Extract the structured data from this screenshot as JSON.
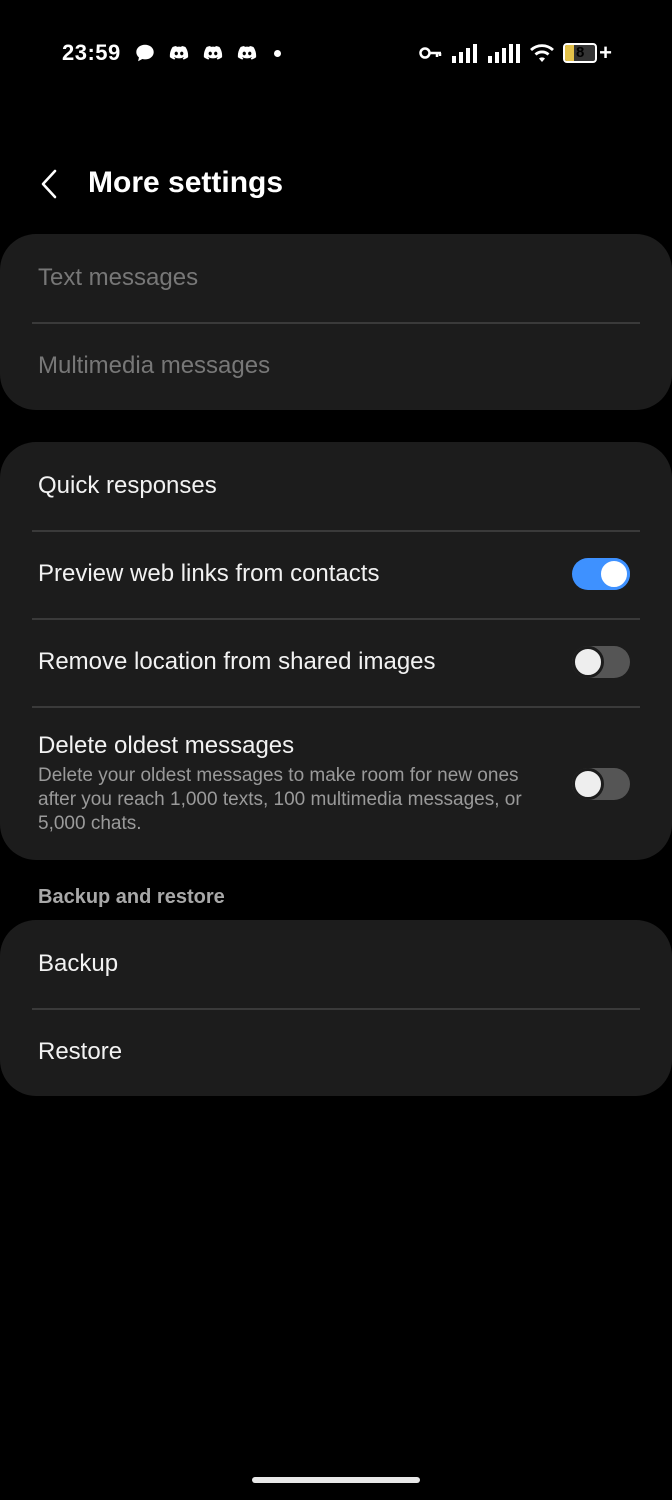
{
  "status_bar": {
    "time": "23:59",
    "notification_icons": [
      "chat-bubble-icon",
      "discord-icon",
      "discord-icon",
      "discord-icon"
    ],
    "system_icons": [
      "vpn-key-icon",
      "signal-icon",
      "signal-icon",
      "wifi-icon"
    ],
    "battery_level": "8",
    "battery_color": "#e3c14a"
  },
  "header": {
    "title": "More settings"
  },
  "group1": {
    "items": [
      {
        "label": "Text messages"
      },
      {
        "label": "Multimedia messages"
      }
    ]
  },
  "group2": {
    "items": [
      {
        "label": "Quick responses"
      },
      {
        "label": "Preview web links from contacts",
        "toggle": "on"
      },
      {
        "label": "Remove location from shared images",
        "toggle": "off"
      },
      {
        "label": "Delete oldest messages",
        "description": "Delete your oldest messages to make room for new ones after you reach 1,000 texts, 100 multimedia messages, or 5,000 chats.",
        "toggle": "off"
      }
    ]
  },
  "backup_section": {
    "header": "Backup and restore",
    "items": [
      {
        "label": "Backup"
      },
      {
        "label": "Restore"
      }
    ]
  },
  "colors": {
    "accent": "#3e91ff",
    "card_bg": "#1c1c1c",
    "background": "#000000"
  }
}
